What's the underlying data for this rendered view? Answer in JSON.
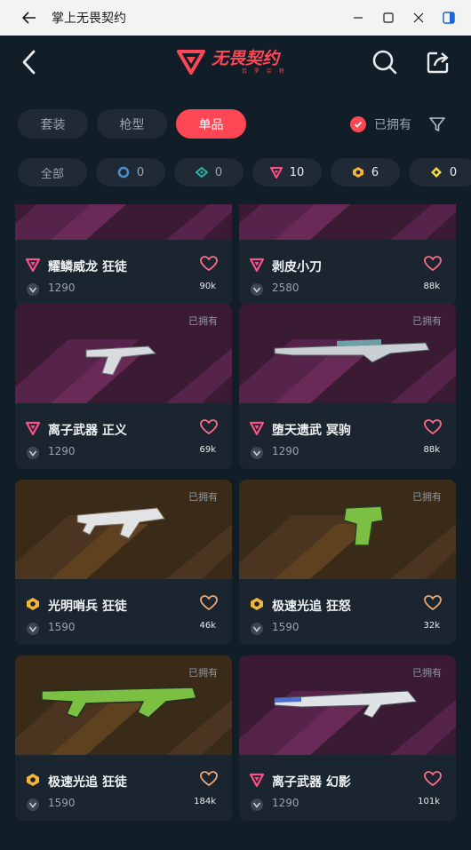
{
  "window": {
    "title": "掌上无畏契约"
  },
  "header": {
    "logo_text": "无畏契约",
    "logo_sub": "瓦 罗 兰 特"
  },
  "tabs": [
    {
      "label": "套装",
      "active": false
    },
    {
      "label": "枪型",
      "active": false
    },
    {
      "label": "单品",
      "active": true
    }
  ],
  "owned_filter": {
    "label": "已拥有",
    "checked": true
  },
  "tiers": [
    {
      "label": "全部",
      "icon": "all"
    },
    {
      "icon": "select-tier-icon",
      "color": "#4a8fd6",
      "count": "0"
    },
    {
      "icon": "deluxe-tier-icon",
      "color": "#2ab3a0",
      "count": "0"
    },
    {
      "icon": "premium-tier-icon",
      "color": "#ff4f8b",
      "count": "10"
    },
    {
      "icon": "exclusive-tier-icon",
      "color": "#f5b53a",
      "count": "6"
    },
    {
      "icon": "ultra-tier-icon",
      "color": "#f7d93e",
      "count": "0"
    }
  ],
  "cards": [
    {
      "name": "耀鳞威龙 狂徒",
      "price": "1290",
      "likes": "90k",
      "owned_label": "",
      "tier": "premium",
      "theme": "purple"
    },
    {
      "name": "剥皮小刀",
      "price": "2580",
      "likes": "88k",
      "owned_label": "",
      "tier": "premium",
      "theme": "purple"
    },
    {
      "name": "离子武器 正义",
      "price": "1290",
      "likes": "69k",
      "owned_label": "已拥有",
      "tier": "premium",
      "theme": "purple"
    },
    {
      "name": "堕天遗武 冥驹",
      "price": "1290",
      "likes": "88k",
      "owned_label": "已拥有",
      "tier": "premium",
      "theme": "purple"
    },
    {
      "name": "光明哨兵 狂徒",
      "price": "1590",
      "likes": "46k",
      "owned_label": "已拥有",
      "tier": "exclusive",
      "theme": "gold"
    },
    {
      "name": "极速光追 狂怒",
      "price": "1590",
      "likes": "32k",
      "owned_label": "已拥有",
      "tier": "exclusive",
      "theme": "gold"
    },
    {
      "name": "极速光追 狂徒",
      "price": "1590",
      "likes": "184k",
      "owned_label": "已拥有",
      "tier": "exclusive",
      "theme": "gold"
    },
    {
      "name": "离子武器 幻影",
      "price": "1290",
      "likes": "101k",
      "owned_label": "已拥有",
      "tier": "premium",
      "theme": "purple"
    }
  ],
  "colors": {
    "accent": "#ff4655",
    "bg": "#111d27",
    "card": "#1a2530",
    "premium": "#ff4f8b",
    "exclusive": "#f5b53a"
  }
}
